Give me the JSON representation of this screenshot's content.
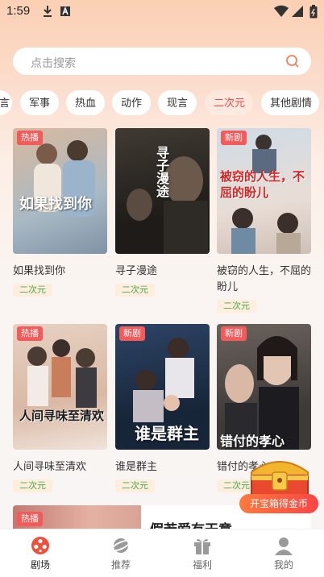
{
  "status_bar": {
    "time": "1:59"
  },
  "search": {
    "placeholder": "点击搜索"
  },
  "categories": [
    {
      "label": "言",
      "active": false
    },
    {
      "label": "军事",
      "active": false
    },
    {
      "label": "热血",
      "active": false
    },
    {
      "label": "动作",
      "active": false
    },
    {
      "label": "现言",
      "active": false
    },
    {
      "label": "二次元",
      "active": true
    },
    {
      "label": "其他剧情",
      "active": false
    }
  ],
  "dramas": [
    {
      "title": "如果找到你",
      "tag": "热播",
      "genre": "二次元",
      "poster_text": "如果找到你",
      "colors": [
        "#c9a68e",
        "#8fa6b7"
      ]
    },
    {
      "title": "寻子漫途",
      "tag": "",
      "genre": "二次元",
      "poster_text": "寻子漫途",
      "colors": [
        "#2a2622",
        "#55493d"
      ]
    },
    {
      "title": "被窃的人生，不屈的盼儿",
      "tag": "新剧",
      "genre": "二次元",
      "poster_text": "被窃的人生，不屈的盼儿",
      "colors": [
        "#c9d6e1",
        "#e2d4cc"
      ]
    },
    {
      "title": "人间寻味至清欢",
      "tag": "热播",
      "genre": "二次元",
      "poster_text": "人间寻味至清欢",
      "colors": [
        "#ddbaa6",
        "#e9d3c6"
      ]
    },
    {
      "title": "谁是群主",
      "tag": "新剧",
      "genre": "二次元",
      "poster_text": "谁是群主",
      "colors": [
        "#1d2f4a",
        "#3c567a"
      ]
    },
    {
      "title": "错付的孝心",
      "tag": "新剧",
      "genre": "二次元",
      "poster_text": "错付的孝心",
      "colors": [
        "#403c3a",
        "#8a8079"
      ]
    }
  ],
  "banner": {
    "tag": "热播",
    "title": "假若爱有天意"
  },
  "treasure": {
    "label": "开宝箱得金币"
  },
  "tabs": [
    {
      "label": "剧场",
      "active": true
    },
    {
      "label": "推荐",
      "active": false
    },
    {
      "label": "福利",
      "active": false
    },
    {
      "label": "我的",
      "active": false
    }
  ],
  "colors": {
    "accent": "#f04a4a",
    "genre_green": "#4ca64c",
    "genre_bg": "#fdeedd",
    "tag_red": "#f35a5a"
  }
}
